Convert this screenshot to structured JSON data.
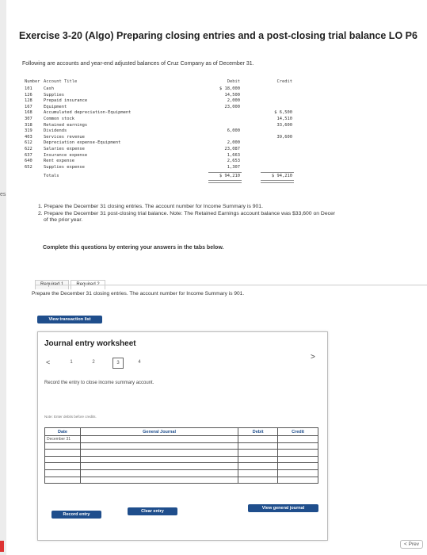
{
  "side_label": "es",
  "title": "Exercise 3-20 (Algo) Preparing closing entries and a post-closing trial balance LO P6",
  "intro": "Following are accounts and year-end adjusted balances of Cruz Company as of December 31.",
  "trial_balance": {
    "headers": {
      "number": "Number",
      "title": "Account Title",
      "debit": "Debit",
      "credit": "Credit"
    },
    "rows": [
      {
        "number": "101",
        "title": "Cash",
        "debit": "$ 18,000",
        "credit": ""
      },
      {
        "number": "126",
        "title": "Supplies",
        "debit": "14,500",
        "credit": ""
      },
      {
        "number": "128",
        "title": "Prepaid insurance",
        "debit": "2,000",
        "credit": ""
      },
      {
        "number": "167",
        "title": "Equipment",
        "debit": "23,000",
        "credit": ""
      },
      {
        "number": "168",
        "title": "Accumulated depreciation-Equipment",
        "debit": "",
        "credit": "$ 6,500"
      },
      {
        "number": "307",
        "title": "Common stock",
        "debit": "",
        "credit": "14,510"
      },
      {
        "number": "318",
        "title": "Retained earnings",
        "debit": "",
        "credit": "33,600"
      },
      {
        "number": "319",
        "title": "Dividends",
        "debit": "6,000",
        "credit": ""
      },
      {
        "number": "403",
        "title": "Services revenue",
        "debit": "",
        "credit": "39,600"
      },
      {
        "number": "612",
        "title": "Depreciation expense-Equipment",
        "debit": "2,000",
        "credit": ""
      },
      {
        "number": "622",
        "title": "Salaries expense",
        "debit": "23,087",
        "credit": ""
      },
      {
        "number": "637",
        "title": "Insurance expense",
        "debit": "1,663",
        "credit": ""
      },
      {
        "number": "640",
        "title": "Rent expense",
        "debit": "2,653",
        "credit": ""
      },
      {
        "number": "652",
        "title": "Supplies expense",
        "debit": "1,307",
        "credit": ""
      }
    ],
    "totals": {
      "label": "Totals",
      "debit": "$ 94,210",
      "credit": "$ 94,210"
    }
  },
  "requirements": [
    "1. Prepare the December 31 closing entries. The account number for Income Summary is 901.",
    "2. Prepare the December 31 post-closing trial balance. Note: The Retained Earnings account balance was $33,600 on Decer",
    "of the prior year."
  ],
  "complete_instruction": "Complete this questions by entering your answers in the tabs below.",
  "tabs": [
    "Required 1",
    "Required 2"
  ],
  "prompt": "Prepare the December 31 closing entries. The account number for Income Summary is 901.",
  "view_transaction_list": "View transaction list",
  "worksheet": {
    "title": "Journal entry worksheet",
    "pages": [
      "1",
      "2",
      "3",
      "4"
    ],
    "selected_page": "3",
    "prev_arrow": "<",
    "next_arrow": ">",
    "instruction": "Record the entry to close income summary account.",
    "note": "Note: Enter debits before credits.",
    "columns": {
      "date": "Date",
      "journal": "General Journal",
      "debit": "Debit",
      "credit": "Credit"
    },
    "date_value": "December 31",
    "row_count": 7,
    "record_entry": "Record entry",
    "clear_entry": "Clear entry",
    "view_general_journal": "View general journal"
  },
  "prev_button": "Prev"
}
